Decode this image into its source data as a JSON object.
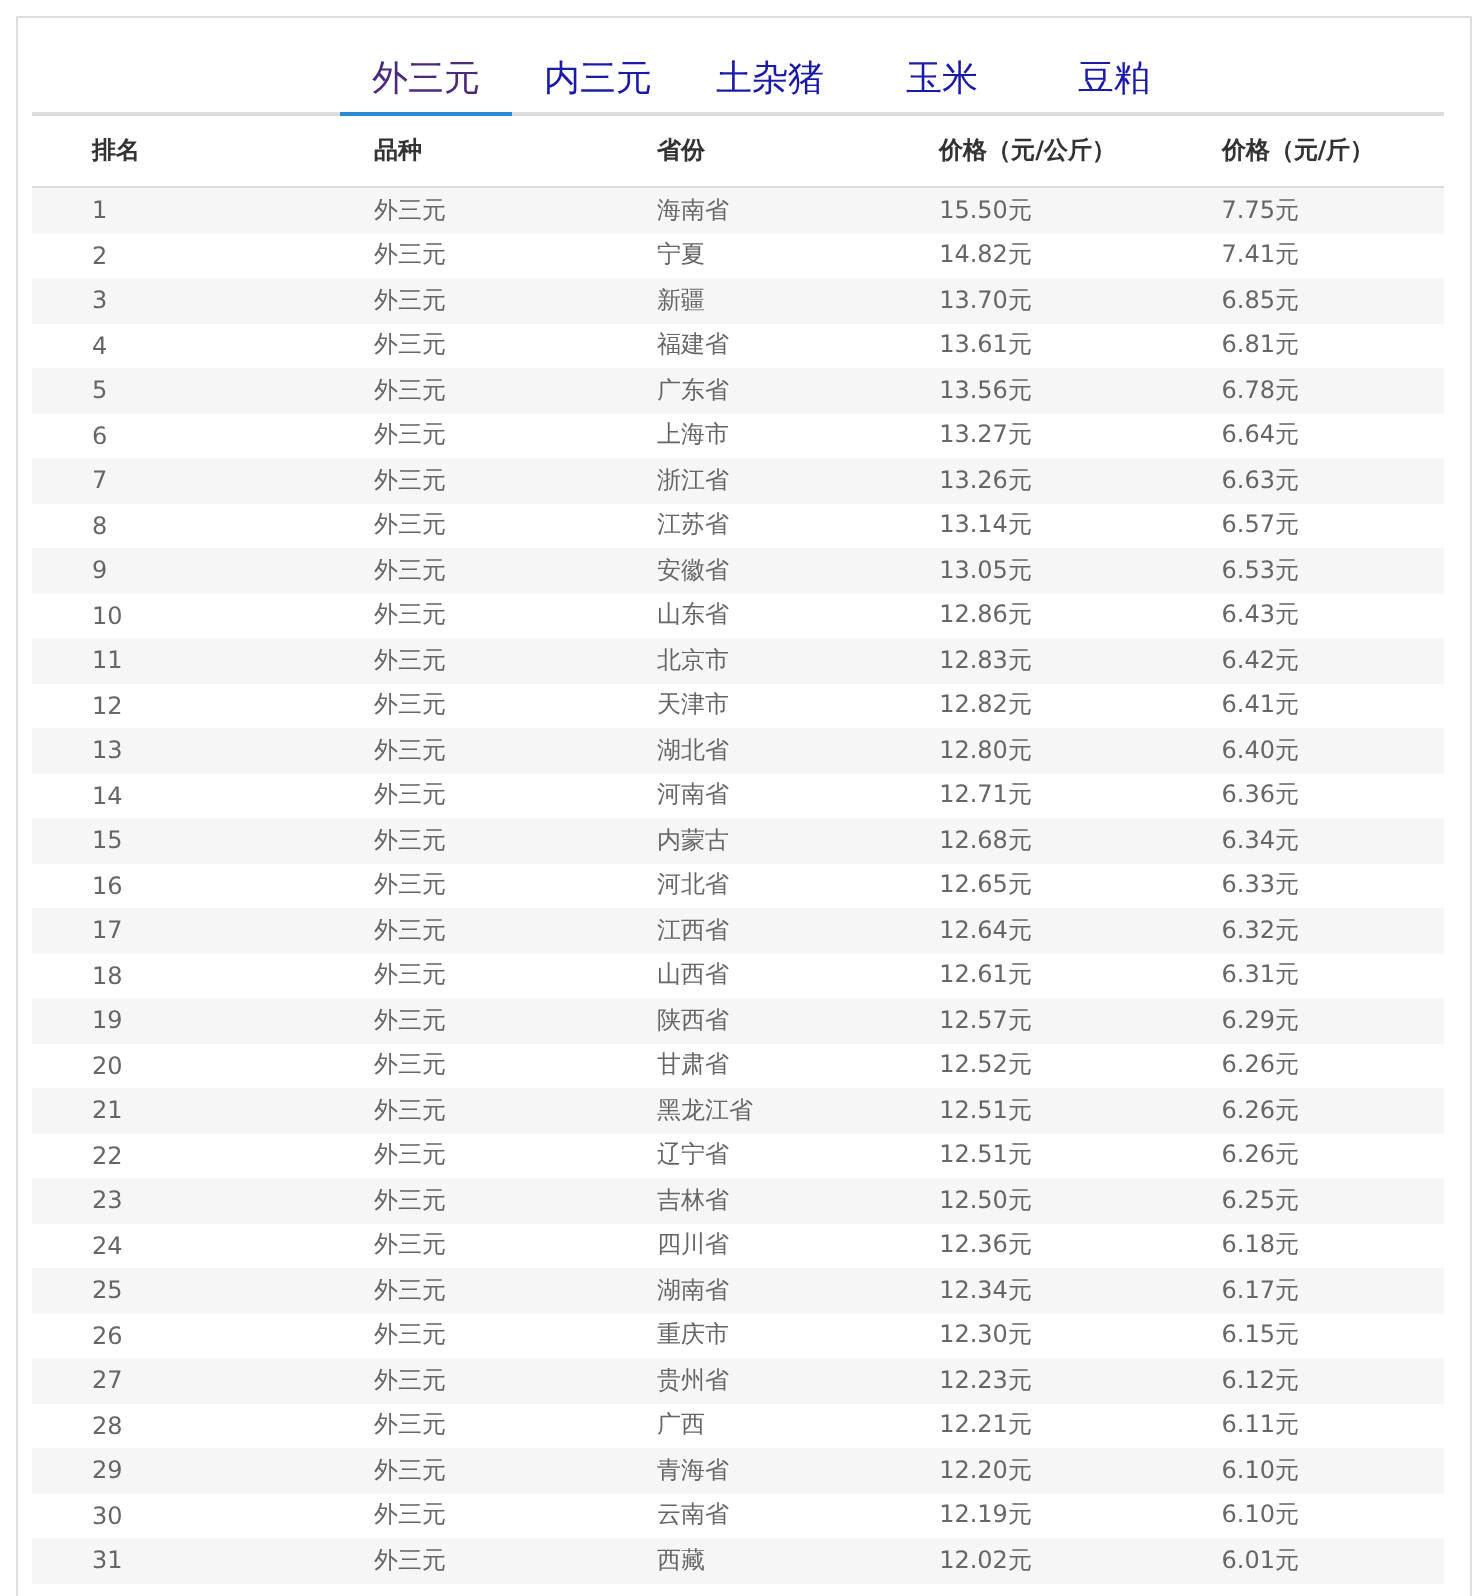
{
  "tabs": [
    {
      "label": "外三元",
      "selected": true
    },
    {
      "label": "内三元",
      "selected": false
    },
    {
      "label": "土杂猪",
      "selected": false
    },
    {
      "label": "玉米",
      "selected": false
    },
    {
      "label": "豆粕",
      "selected": false
    }
  ],
  "table": {
    "columns": [
      "排名",
      "品种",
      "省份",
      "价格（元/公斤）",
      "价格（元/斤）"
    ],
    "rows": [
      [
        "1",
        "外三元",
        "海南省",
        "15.50元",
        "7.75元"
      ],
      [
        "2",
        "外三元",
        "宁夏",
        "14.82元",
        "7.41元"
      ],
      [
        "3",
        "外三元",
        "新疆",
        "13.70元",
        "6.85元"
      ],
      [
        "4",
        "外三元",
        "福建省",
        "13.61元",
        "6.81元"
      ],
      [
        "5",
        "外三元",
        "广东省",
        "13.56元",
        "6.78元"
      ],
      [
        "6",
        "外三元",
        "上海市",
        "13.27元",
        "6.64元"
      ],
      [
        "7",
        "外三元",
        "浙江省",
        "13.26元",
        "6.63元"
      ],
      [
        "8",
        "外三元",
        "江苏省",
        "13.14元",
        "6.57元"
      ],
      [
        "9",
        "外三元",
        "安徽省",
        "13.05元",
        "6.53元"
      ],
      [
        "10",
        "外三元",
        "山东省",
        "12.86元",
        "6.43元"
      ],
      [
        "11",
        "外三元",
        "北京市",
        "12.83元",
        "6.42元"
      ],
      [
        "12",
        "外三元",
        "天津市",
        "12.82元",
        "6.41元"
      ],
      [
        "13",
        "外三元",
        "湖北省",
        "12.80元",
        "6.40元"
      ],
      [
        "14",
        "外三元",
        "河南省",
        "12.71元",
        "6.36元"
      ],
      [
        "15",
        "外三元",
        "内蒙古",
        "12.68元",
        "6.34元"
      ],
      [
        "16",
        "外三元",
        "河北省",
        "12.65元",
        "6.33元"
      ],
      [
        "17",
        "外三元",
        "江西省",
        "12.64元",
        "6.32元"
      ],
      [
        "18",
        "外三元",
        "山西省",
        "12.61元",
        "6.31元"
      ],
      [
        "19",
        "外三元",
        "陕西省",
        "12.57元",
        "6.29元"
      ],
      [
        "20",
        "外三元",
        "甘肃省",
        "12.52元",
        "6.26元"
      ],
      [
        "21",
        "外三元",
        "黑龙江省",
        "12.51元",
        "6.26元"
      ],
      [
        "22",
        "外三元",
        "辽宁省",
        "12.51元",
        "6.26元"
      ],
      [
        "23",
        "外三元",
        "吉林省",
        "12.50元",
        "6.25元"
      ],
      [
        "24",
        "外三元",
        "四川省",
        "12.36元",
        "6.18元"
      ],
      [
        "25",
        "外三元",
        "湖南省",
        "12.34元",
        "6.17元"
      ],
      [
        "26",
        "外三元",
        "重庆市",
        "12.30元",
        "6.15元"
      ],
      [
        "27",
        "外三元",
        "贵州省",
        "12.23元",
        "6.12元"
      ],
      [
        "28",
        "外三元",
        "广西",
        "12.21元",
        "6.11元"
      ],
      [
        "29",
        "外三元",
        "青海省",
        "12.20元",
        "6.10元"
      ],
      [
        "30",
        "外三元",
        "云南省",
        "12.19元",
        "6.10元"
      ],
      [
        "31",
        "外三元",
        "西藏",
        "12.02元",
        "6.01元"
      ]
    ]
  }
}
